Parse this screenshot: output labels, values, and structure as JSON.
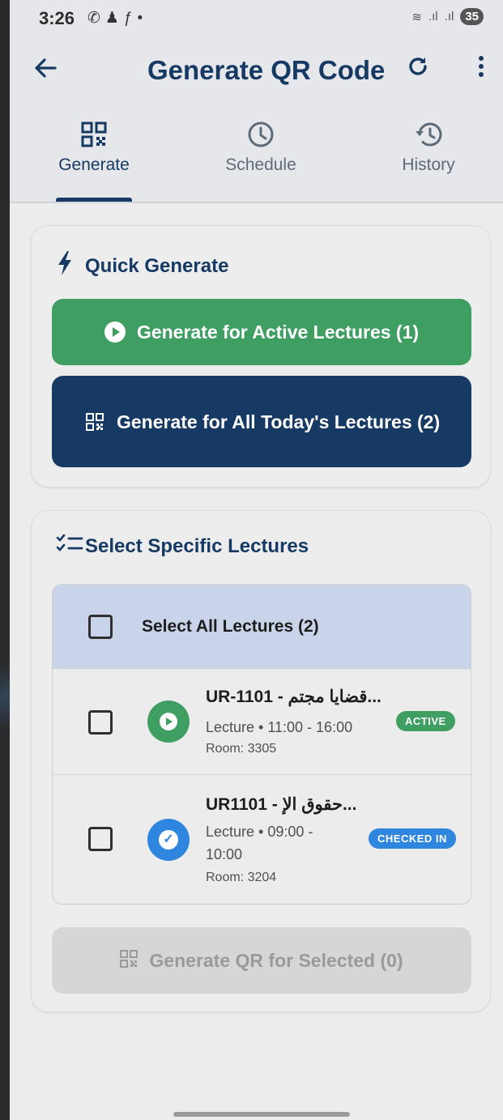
{
  "status_bar": {
    "time": "3:26",
    "battery": "35"
  },
  "app_bar": {
    "title": "Generate QR Code"
  },
  "tabs": [
    {
      "label": "Generate",
      "icon": "qr-code-icon",
      "active": true
    },
    {
      "label": "Schedule",
      "icon": "clock-icon",
      "active": false
    },
    {
      "label": "History",
      "icon": "history-icon",
      "active": false
    }
  ],
  "quick_generate": {
    "title": "Quick Generate",
    "active_button": "Generate for Active Lectures (1)",
    "all_button": "Generate for All Today's Lectures (2)"
  },
  "select_specific": {
    "title": "Select Specific Lectures",
    "select_all_label": "Select All Lectures (2)",
    "lectures": [
      {
        "title": "UR-1101 - قضايا مجتم...",
        "meta": "Lecture • 11:00 - 16:00",
        "room": "Room: 3305",
        "badge": "ACTIVE",
        "status": "active"
      },
      {
        "title": "UR1101 - حقوق الإ...",
        "meta": "Lecture • 09:00 - 10:00",
        "room": "Room: 3204",
        "badge": "CHECKED IN",
        "status": "checked-in"
      }
    ],
    "generate_selected": "Generate QR for Selected (0)"
  },
  "colors": {
    "navy": "#163a63",
    "green": "#3f9e62",
    "blue": "#2f86df",
    "select_all_bg": "#c9d4eb"
  }
}
